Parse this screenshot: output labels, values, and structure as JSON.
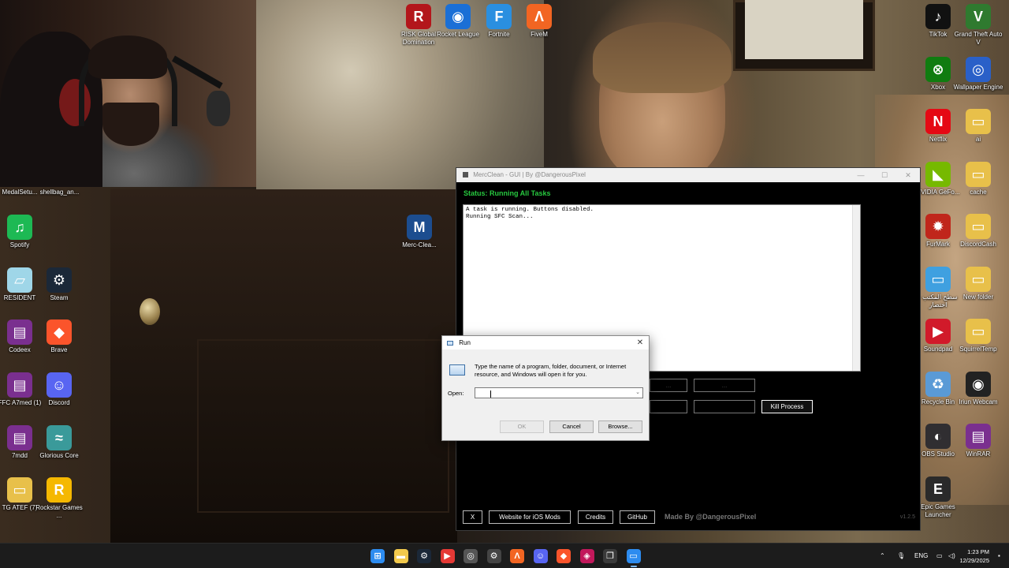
{
  "desktop": {
    "icons_left": [
      {
        "label": "Spotify",
        "glyph": "♫",
        "color": "#1db954"
      },
      {
        "label": "RESIDENT",
        "glyph": "▱",
        "color": "#9fd6e8"
      },
      {
        "label": "Steam",
        "glyph": "⚙",
        "color": "#1b2838"
      },
      {
        "label": "Codeex",
        "glyph": "▤",
        "color": "#7a2f8f"
      },
      {
        "label": "Brave",
        "glyph": "◆",
        "color": "#fb542b"
      },
      {
        "label": "FFC A7med (1)",
        "glyph": "▤",
        "color": "#7a2f8f"
      },
      {
        "label": "Discord",
        "glyph": "☺",
        "color": "#5865f2"
      },
      {
        "label": "7mdd",
        "glyph": "▤",
        "color": "#7a2f8f"
      },
      {
        "label": "Glorious Core",
        "glyph": "≈",
        "color": "#3a9a9a"
      },
      {
        "label": "TG ATEF (7)",
        "glyph": "▭",
        "color": "#e8c04a"
      },
      {
        "label": "Rockstar Games ...",
        "glyph": "R",
        "color": "#f5b800"
      }
    ],
    "icons_top": [
      {
        "label": "RISK Global Domination",
        "glyph": "R",
        "color": "#b3161b"
      },
      {
        "label": "Rocket League",
        "glyph": "◉",
        "color": "#1a6fd6"
      },
      {
        "label": "Fortnite",
        "glyph": "F",
        "color": "#2a8fe0"
      },
      {
        "label": "FiveM",
        "glyph": "Λ",
        "color": "#f26522"
      }
    ],
    "webcam_labels": [
      "MedalSetu...",
      "shellbag_an..."
    ],
    "merc_shortcut": {
      "label": "Merc-Clea...",
      "glyph": "M",
      "color": "#1c4d8f"
    },
    "icons_right": [
      {
        "label": "TikTok",
        "glyph": "♪",
        "color": "#111111"
      },
      {
        "label": "Grand Theft Auto V",
        "glyph": "V",
        "color": "#2f7a2f"
      },
      {
        "label": "Xbox",
        "glyph": "⊗",
        "color": "#107c10"
      },
      {
        "label": "Wallpaper Engine",
        "glyph": "◎",
        "color": "#2a60c8"
      },
      {
        "label": "Netflix",
        "glyph": "N",
        "color": "#e50914"
      },
      {
        "label": "ai",
        "glyph": "▭",
        "color": "#e8c04a"
      },
      {
        "label": "NVIDIA GeFo...",
        "glyph": "◣",
        "color": "#76b900"
      },
      {
        "label": "cache",
        "glyph": "▭",
        "color": "#e8c04a"
      },
      {
        "label": "FurMark",
        "glyph": "✹",
        "color": "#c0261b"
      },
      {
        "label": "DiscordCash",
        "glyph": "▭",
        "color": "#e8c04a"
      },
      {
        "label": "سطح المكتب - اختصار",
        "glyph": "▭",
        "color": "#3fa0e0"
      },
      {
        "label": "New folder",
        "glyph": "▭",
        "color": "#e8c04a"
      },
      {
        "label": "Soundpad",
        "glyph": "▶",
        "color": "#d11a2a"
      },
      {
        "label": "SquirrelTemp",
        "glyph": "▭",
        "color": "#e8c04a"
      },
      {
        "label": "Recycle Bin",
        "glyph": "♻",
        "color": "#5a9ad6"
      },
      {
        "label": "Iriun Webcam",
        "glyph": "◉",
        "color": "#222222"
      },
      {
        "label": "OBS Studio",
        "glyph": "◐",
        "color": "#302e31"
      },
      {
        "label": "WinRAR",
        "glyph": "▤",
        "color": "#7a2f8f"
      },
      {
        "label": "Epic Games Launcher",
        "glyph": "E",
        "color": "#2a2a2a"
      }
    ]
  },
  "merc_window": {
    "title": "MercClean - GUI | By @DangerousPixel",
    "controls": [
      "—",
      "☐",
      "✕"
    ],
    "status": "Status: Running All Tasks",
    "log_lines": [
      "A task is running. Buttons disabled.",
      "Running SFC Scan..."
    ],
    "buttons_row1_partial": [
      "...",
      "..."
    ],
    "kill_button": "Kill Process",
    "bottom_buttons": {
      "x": "X",
      "website": "Website for iOS Mods",
      "credits": "Credits",
      "github": "GitHub"
    },
    "made_by": "Made By @DangerousPixel",
    "version": "v1.2.5"
  },
  "run_dialog": {
    "title": "Run",
    "close": "✕",
    "description": "Type the name of a program, folder, document, or Internet resource, and Windows will open it for you.",
    "open_label": "Open:",
    "open_value": "",
    "ok": "OK",
    "cancel": "Cancel",
    "browse": "Browse..."
  },
  "taskbar": {
    "apps": [
      {
        "name": "start",
        "glyph": "⊞",
        "color": "#2d8cf0"
      },
      {
        "name": "file-explorer",
        "glyph": "▬",
        "color": "#f2c94c"
      },
      {
        "name": "steam",
        "glyph": "⚙",
        "color": "#1b2838"
      },
      {
        "name": "youtube",
        "glyph": "▶",
        "color": "#e53935"
      },
      {
        "name": "chrome",
        "glyph": "◎",
        "color": "#555555"
      },
      {
        "name": "settings",
        "glyph": "⚙",
        "color": "#444444"
      },
      {
        "name": "fivem",
        "glyph": "Λ",
        "color": "#f26522"
      },
      {
        "name": "discord",
        "glyph": "☺",
        "color": "#5865f2"
      },
      {
        "name": "brave",
        "glyph": "◆",
        "color": "#fb542b"
      },
      {
        "name": "vs-code",
        "glyph": "◈",
        "color": "#c2185b"
      },
      {
        "name": "task-view",
        "glyph": "❐",
        "color": "#3a3a3a"
      },
      {
        "name": "merc-clean",
        "glyph": "▭",
        "color": "#2d8cf0"
      }
    ],
    "language": "ENG",
    "time": "1:23 PM",
    "date": "12/29/2025"
  }
}
